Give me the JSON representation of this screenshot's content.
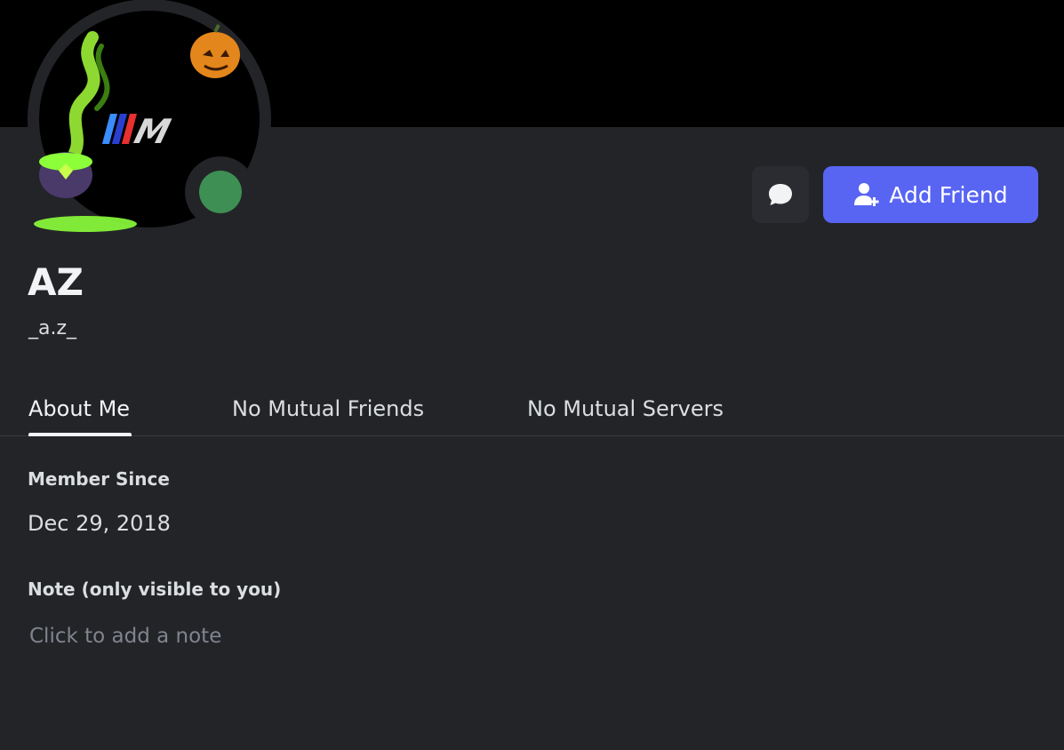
{
  "profile": {
    "display_name": "AZ",
    "username": "_a.z_",
    "status_color": "#43a25a",
    "avatar_logo_text": "M"
  },
  "actions": {
    "message_icon": "chat-bubble-icon",
    "add_friend_label": "Add Friend",
    "add_friend_icon": "add-user-icon",
    "accent_color": "#5865f2"
  },
  "tabs": [
    {
      "label": "About Me",
      "active": true
    },
    {
      "label": "No Mutual Friends",
      "active": false
    },
    {
      "label": "No Mutual Servers",
      "active": false
    }
  ],
  "about": {
    "member_since_heading": "Member Since",
    "member_since_value": "Dec 29, 2018",
    "note_heading": "Note (only visible to you)",
    "note_placeholder": "Click to add a note"
  }
}
